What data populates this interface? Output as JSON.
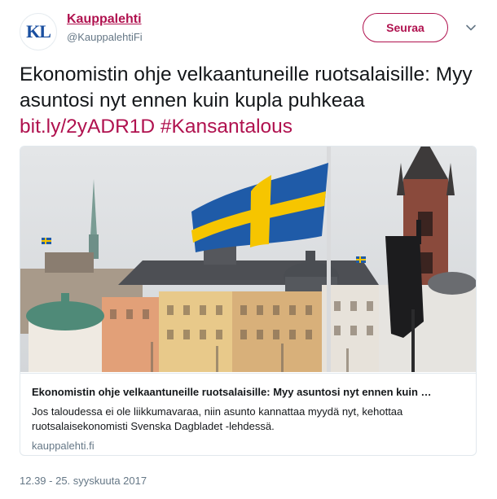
{
  "author": {
    "display_name": "Kauppalehti",
    "handle": "@KauppalehtiFi",
    "avatar_text": "KL",
    "avatar_icon": "kauppalehti-logo"
  },
  "follow_label": "Seuraa",
  "menu_icon": "chevron-down-icon",
  "tweet": {
    "text": "Ekonomistin ohje velkaantuneille ruotsalaisille: Myy asuntosi nyt ennen kuin kupla puhkeaa",
    "link": "bit.ly/2yADR1D",
    "hashtag": "#Kansantalous"
  },
  "card": {
    "title": "Ekonomistin ohje velkaantuneille ruotsalaisille: Myy asuntosi nyt ennen kuin …",
    "description": "Jos taloudessa ei ole liikkumavaraa, niin asunto kannattaa myydä nyt, kehottaa ruotsalaisekonomisti Svenska Dagbladet -lehdessä.",
    "domain": "kauppalehti.fi",
    "image_icon": "stockholm-swedish-flag-photo"
  },
  "timestamp": "12.39 - 25. syyskuuta 2017",
  "colors": {
    "brand": "#b0124f",
    "secondary_text": "#657786",
    "flag_blue": "#1f5ba8",
    "flag_yellow": "#f6c500"
  }
}
